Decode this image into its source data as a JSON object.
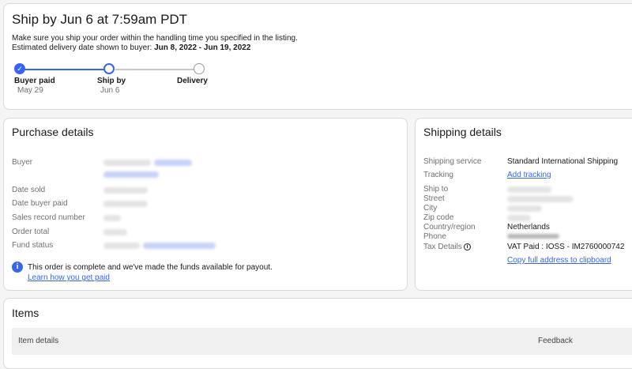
{
  "ship": {
    "title": "Ship by Jun 6 at 7:59am PDT",
    "note_line1": "Make sure you ship your order within the handling time you specified in the listing.",
    "note_line2_prefix": "Estimated delivery date shown to buyer: ",
    "note_line2_dates": "Jun 8, 2022 - Jun 19, 2022",
    "steps": [
      {
        "label": "Buyer paid",
        "date": "May 29",
        "state": "complete"
      },
      {
        "label": "Ship by",
        "date": "Jun 6",
        "state": "current"
      },
      {
        "label": "Delivery",
        "date": "",
        "state": "pending"
      }
    ],
    "colors": {
      "accent": "#3665f3",
      "track": "#c7c7c7"
    }
  },
  "purchase": {
    "title": "Purchase details",
    "labels": {
      "buyer": "Buyer",
      "date_sold": "Date sold",
      "date_paid": "Date buyer paid",
      "sales_record": "Sales record number",
      "order_total": "Order total",
      "fund_status": "Fund status"
    },
    "notice": "This order is complete and we've made the funds available for payout.",
    "notice_link": "Learn how you get paid",
    "info_icon": "i"
  },
  "shipping": {
    "title": "Shipping details",
    "labels": {
      "service": "Shipping service",
      "tracking": "Tracking",
      "ship_to": "Ship to",
      "street": "Street",
      "city": "City",
      "zip": "Zip code",
      "country": "Country/region",
      "phone": "Phone",
      "tax": "Tax Details"
    },
    "service_value": "Standard International Shipping",
    "tracking_link": "Add tracking",
    "country_value": "Netherlands",
    "tax_value": "VAT Paid : IOSS - IM2760000742",
    "copy_link": "Copy full address to clipboard",
    "tax_icon": "i"
  },
  "items": {
    "title": "Items",
    "col_item_details": "Item details",
    "col_feedback": "Feedback"
  }
}
